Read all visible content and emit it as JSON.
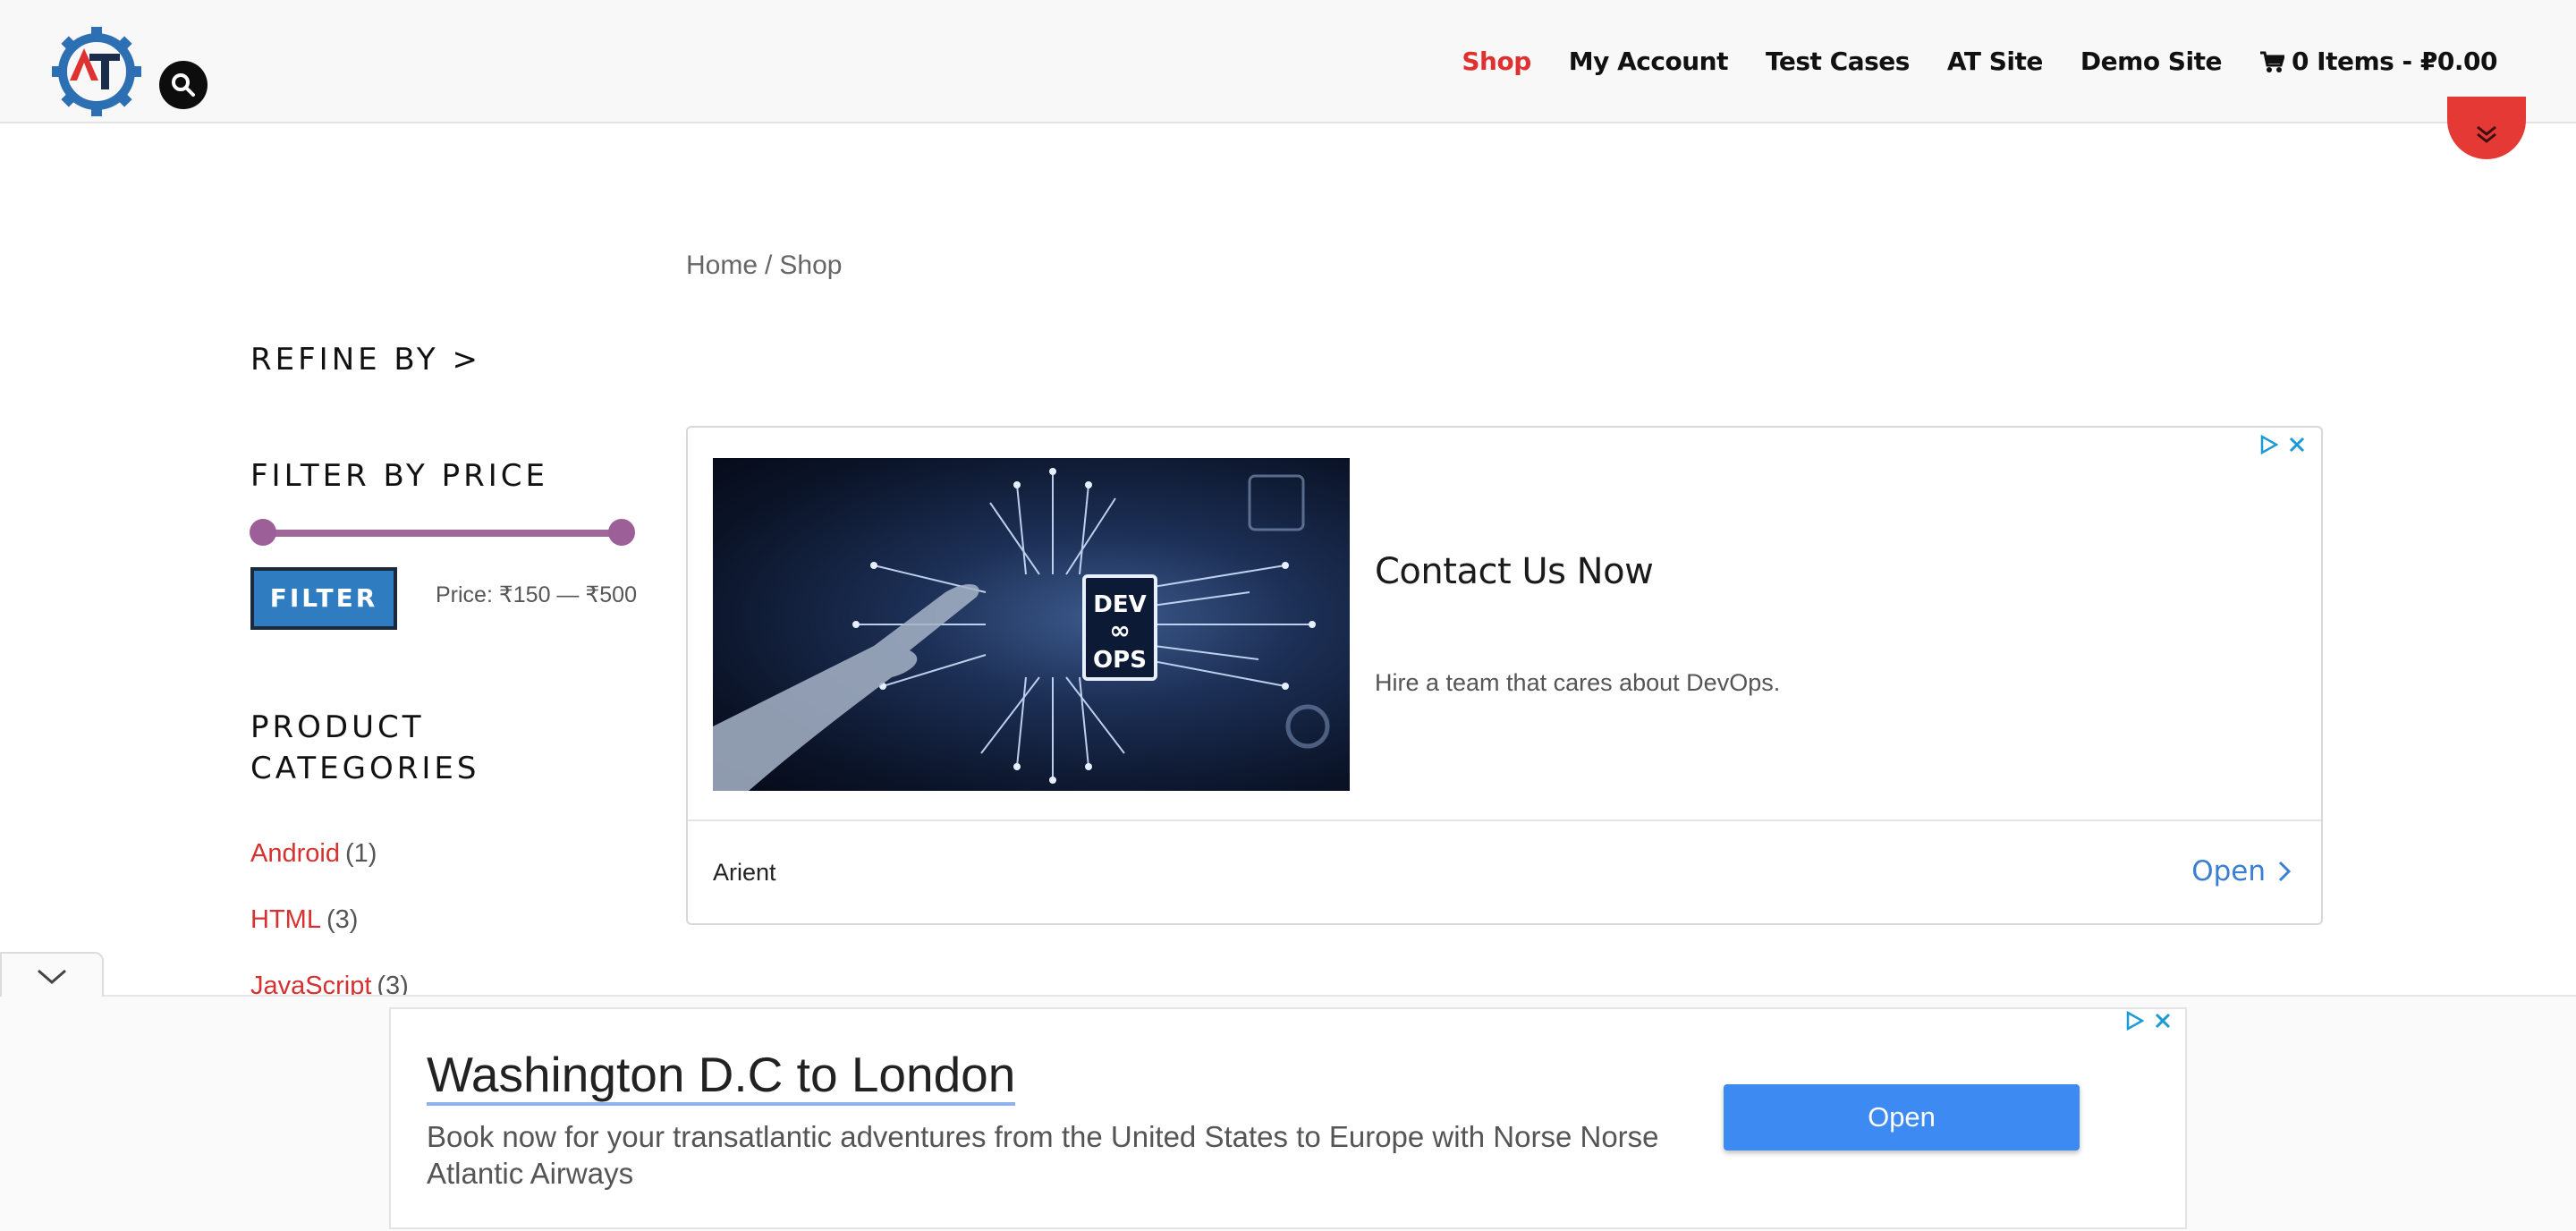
{
  "header": {
    "logo_text": "AT",
    "nav": [
      {
        "label": "Shop",
        "active": true
      },
      {
        "label": "My Account"
      },
      {
        "label": "Test Cases"
      },
      {
        "label": "AT Site"
      },
      {
        "label": "Demo Site"
      }
    ],
    "cart_label": "0 Items - ₽0.00"
  },
  "breadcrumb": {
    "home": "Home",
    "sep": "/",
    "current": "Shop"
  },
  "sidebar": {
    "refine_by": "REFINE BY >",
    "filter_by_price": "FILTER BY PRICE",
    "filter_button": "FILTER",
    "price_text": "Price: ₹150 — ₹500",
    "product_categories": "PRODUCT CATEGORIES",
    "categories": [
      {
        "name": "Android",
        "count": "(1)"
      },
      {
        "name": "HTML",
        "count": "(3)"
      },
      {
        "name": "JavaScript",
        "count": "(3)"
      }
    ]
  },
  "ad": {
    "image_label_top": "DEV",
    "image_label_mid": "∞",
    "image_label_bottom": "OPS",
    "headline": "Contact Us Now",
    "description": "Hire a team that cares about DevOps.",
    "advertiser": "Arient",
    "open_label": "Open"
  },
  "anchor_ad": {
    "title": "Washington D.C to London",
    "description": "Book now for your transatlantic adventures from the United States to Europe with Norse Norse Atlantic Airways",
    "open_label": "Open"
  },
  "colors": {
    "accent_red": "#e03131",
    "filter_blue": "#2f7dc0",
    "slider_purple": "#a0689a",
    "link_blue": "#3b7fd4"
  }
}
